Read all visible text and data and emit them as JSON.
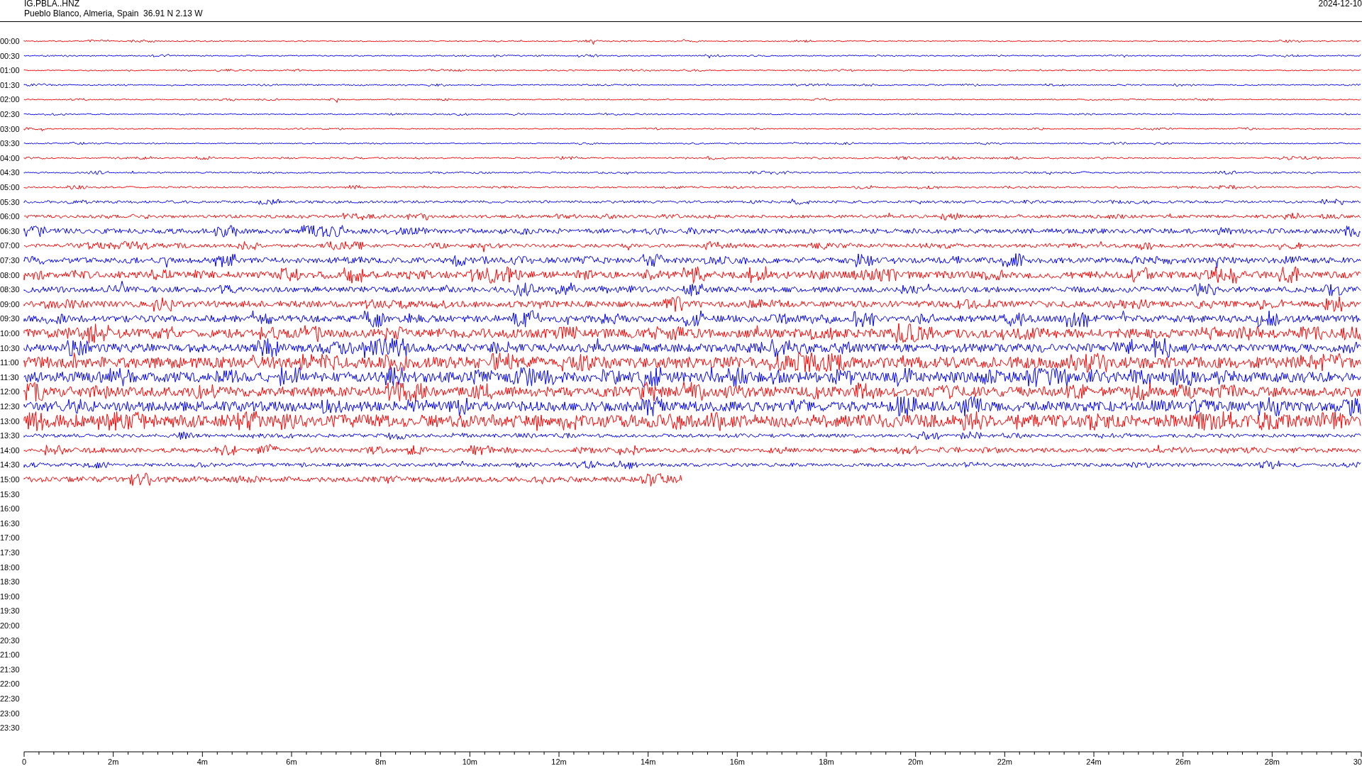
{
  "header": {
    "station": "IG.PBLA..HNZ",
    "location": "Pueblo Blanco, Almeria, Spain  36.91 N 2.13 W",
    "date": "2024-12-10"
  },
  "rows": [
    {
      "time": "00:00",
      "kind": "trace",
      "color": "#ff0000"
    },
    {
      "time": "00:30",
      "kind": "trace",
      "color": "#0000ff"
    },
    {
      "time": "01:00",
      "kind": "trace",
      "color": "#ff0000"
    },
    {
      "time": "01:30",
      "kind": "trace",
      "color": "#0000ff"
    },
    {
      "time": "02:00",
      "kind": "trace",
      "color": "#ff0000"
    },
    {
      "time": "02:30",
      "kind": "trace",
      "color": "#0000ff"
    },
    {
      "time": "03:00",
      "kind": "trace",
      "color": "#ff0000"
    },
    {
      "time": "03:30",
      "kind": "trace",
      "color": "#0000ff"
    },
    {
      "time": "04:00",
      "kind": "trace",
      "color": "#ff0000"
    },
    {
      "time": "04:30",
      "kind": "trace",
      "color": "#0000ff"
    },
    {
      "time": "05:00",
      "kind": "trace",
      "color": "#ff0000"
    },
    {
      "time": "05:30",
      "kind": "trace",
      "color": "#0000ff"
    },
    {
      "time": "06:00",
      "kind": "trace",
      "color": "#ff0000"
    },
    {
      "time": "06:30",
      "kind": "trace",
      "color": "#0000ff"
    },
    {
      "time": "07:00",
      "kind": "trace",
      "color": "#ff0000"
    },
    {
      "time": "07:30",
      "kind": "trace",
      "color": "#0000ff"
    },
    {
      "time": "08:00",
      "kind": "trace",
      "color": "#ff0000"
    },
    {
      "time": "08:30",
      "kind": "trace",
      "color": "#0000ff"
    },
    {
      "time": "09:00",
      "kind": "trace",
      "color": "#ff0000"
    },
    {
      "time": "09:30",
      "kind": "trace",
      "color": "#0000ff"
    },
    {
      "time": "10:00",
      "kind": "trace",
      "color": "#ff0000"
    },
    {
      "time": "10:30",
      "kind": "trace",
      "color": "#0000ff"
    },
    {
      "time": "11:00",
      "kind": "trace",
      "color": "#ff0000"
    },
    {
      "time": "11:30",
      "kind": "trace",
      "color": "#0000ff"
    },
    {
      "time": "12:00",
      "kind": "trace",
      "color": "#ff0000"
    },
    {
      "time": "12:30",
      "kind": "trace",
      "color": "#0000ff"
    },
    {
      "time": "13:00",
      "kind": "trace",
      "color": "#ff0000"
    },
    {
      "time": "13:30",
      "kind": "trace",
      "color": "#0000ff"
    },
    {
      "time": "14:00",
      "kind": "trace",
      "color": "#ff0000"
    },
    {
      "time": "14:30",
      "kind": "trace",
      "color": "#0000ff"
    },
    {
      "time": "15:00",
      "kind": "partial",
      "color": "#ff0000"
    },
    {
      "time": "15:30",
      "kind": "empty"
    },
    {
      "time": "16:00",
      "kind": "empty"
    },
    {
      "time": "16:30",
      "kind": "empty"
    },
    {
      "time": "17:00",
      "kind": "empty"
    },
    {
      "time": "17:30",
      "kind": "empty"
    },
    {
      "time": "18:00",
      "kind": "empty"
    },
    {
      "time": "18:30",
      "kind": "empty"
    },
    {
      "time": "19:00",
      "kind": "empty"
    },
    {
      "time": "19:30",
      "kind": "empty"
    },
    {
      "time": "20:00",
      "kind": "empty"
    },
    {
      "time": "20:30",
      "kind": "empty"
    },
    {
      "time": "21:00",
      "kind": "empty"
    },
    {
      "time": "21:30",
      "kind": "empty"
    },
    {
      "time": "22:00",
      "kind": "empty"
    },
    {
      "time": "22:30",
      "kind": "empty"
    },
    {
      "time": "23:00",
      "kind": "empty"
    },
    {
      "time": "23:30",
      "kind": "empty"
    }
  ],
  "x_axis": {
    "ticks": [
      "0",
      "2m",
      "4m",
      "6m",
      "8m",
      "10m",
      "12m",
      "14m",
      "16m",
      "18m",
      "20m",
      "22m",
      "24m",
      "26m",
      "28m",
      "30"
    ]
  }
}
